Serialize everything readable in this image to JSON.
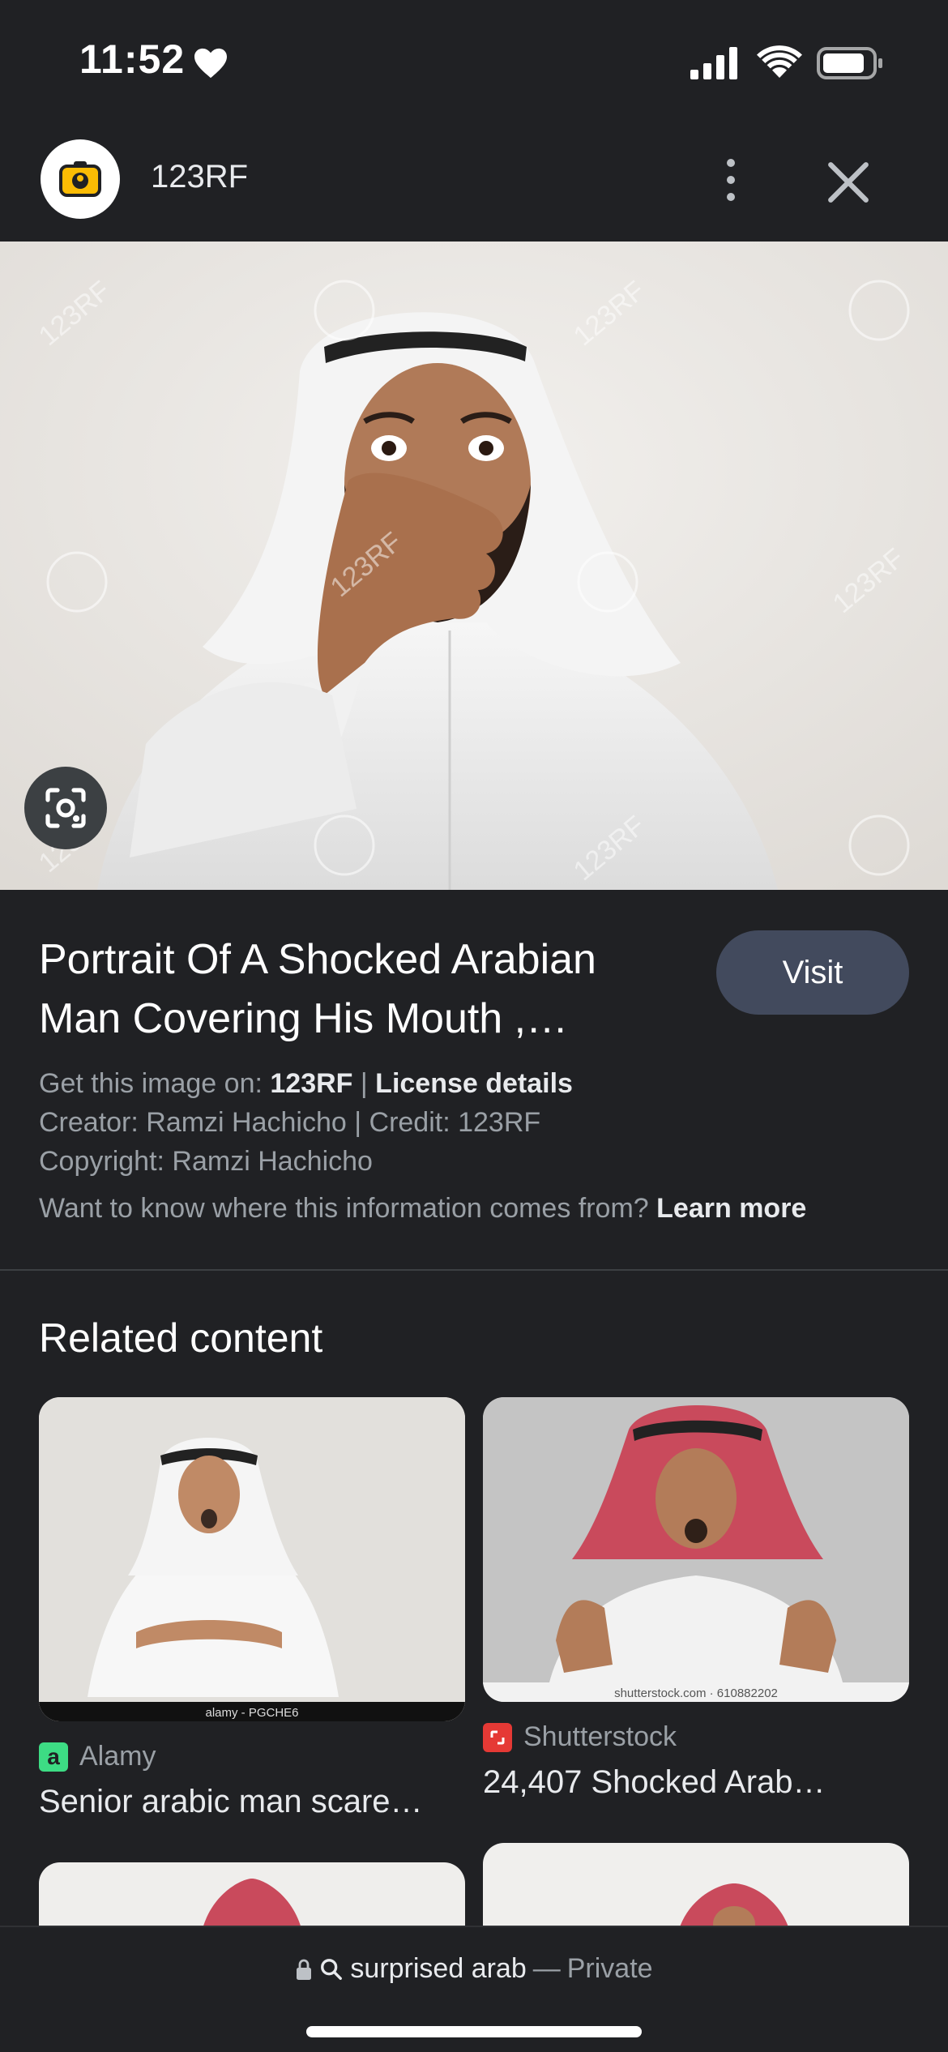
{
  "status_bar": {
    "time": "11:52",
    "icons": [
      "heart-icon",
      "cellular-signal-icon",
      "wifi-icon",
      "battery-icon"
    ]
  },
  "header": {
    "site_name": "123RF",
    "logo_icon": "camera-logo-icon",
    "more_icon": "more-vertical-icon",
    "close_icon": "close-icon"
  },
  "hero": {
    "alt": "Portrait of a shocked Arabian man covering his mouth",
    "watermark": "123RF",
    "lens_icon": "lens-search-icon"
  },
  "result": {
    "title": "Portrait Of A Shocked Arabian Man Covering His Mouth ,…",
    "visit_label": "Visit",
    "get_image_prefix": "Get this image on: ",
    "get_image_source": "123RF",
    "separator": " | ",
    "license_label": "License details",
    "creator_line": "Creator: Ramzi Hachicho | Credit: 123RF",
    "copyright_line": "Copyright: Ramzi Hachicho",
    "info_question": "Want to know where this information comes from? ",
    "learn_more": "Learn more"
  },
  "related": {
    "heading": "Related content",
    "items": [
      {
        "source": "Alamy",
        "favicon_letter": "a",
        "caption": "Senior arabic man scare…",
        "image_label": "alamy - PGCHE6"
      },
      {
        "source": "Shutterstock",
        "caption": "24,407 Shocked Arab…",
        "image_label": "shutterstock.com · 610882202"
      }
    ]
  },
  "bottom": {
    "query": "surprised arab",
    "dash": "—",
    "mode": "Private",
    "lock_icon": "lock-icon",
    "search_icon": "search-icon"
  },
  "colors": {
    "background": "#202124",
    "visit_button": "#424a5d",
    "alamy_favicon": "#3ddc84",
    "shutterstock_favicon": "#e53935"
  }
}
